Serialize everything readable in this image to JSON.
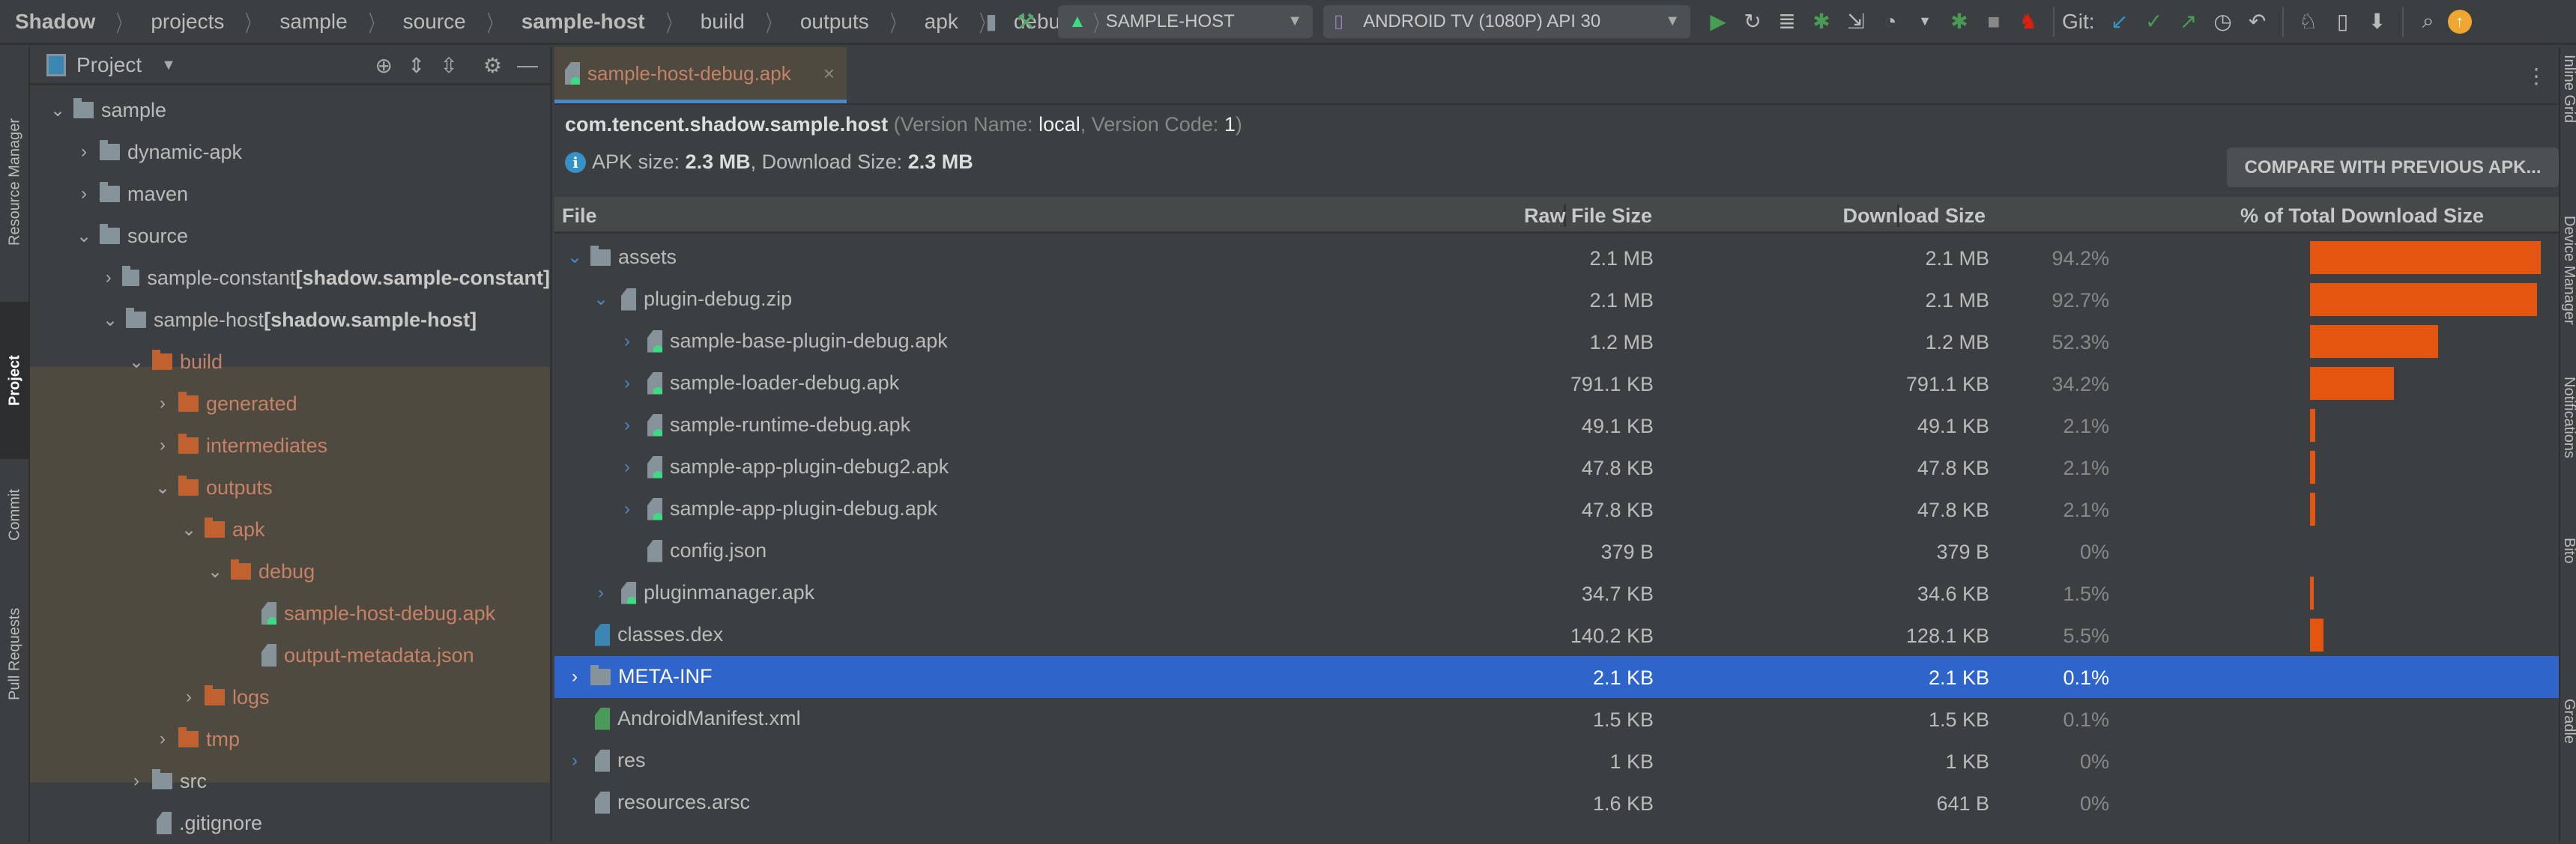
{
  "breadcrumbs": [
    {
      "label": "Shadow",
      "bold": true
    },
    {
      "label": "projects"
    },
    {
      "label": "sample"
    },
    {
      "label": "source"
    },
    {
      "label": "sample-host",
      "bold": true
    },
    {
      "label": "build"
    },
    {
      "label": "outputs"
    },
    {
      "label": "apk"
    },
    {
      "label": "debug"
    }
  ],
  "toolbar": {
    "run_config": "SAMPLE-HOST",
    "device": "ANDROID TV (1080P) API 30",
    "git_label": "Git:"
  },
  "left_strip": {
    "resource_manager": "Resource Manager",
    "project": "Project",
    "commit": "Commit",
    "pull_requests": "Pull Requests"
  },
  "right_strip": {
    "items": [
      "Inline Grid",
      "Device Manager",
      "Notifications",
      "Bito",
      "Gradle"
    ]
  },
  "project_panel": {
    "title": "Project",
    "tree": [
      {
        "label": "sample",
        "depth": 0,
        "chev": "down",
        "icon": "folder"
      },
      {
        "label": "dynamic-apk",
        "depth": 1,
        "chev": "right",
        "icon": "folder"
      },
      {
        "label": "maven",
        "depth": 1,
        "chev": "right",
        "icon": "folder"
      },
      {
        "label": "source",
        "depth": 1,
        "chev": "down",
        "icon": "folder"
      },
      {
        "label": "sample-constant ",
        "suffix": "[shadow.sample-constant]",
        "depth": 2,
        "chev": "right",
        "icon": "module"
      },
      {
        "label": "sample-host ",
        "suffix": "[shadow.sample-host]",
        "depth": 2,
        "chev": "down",
        "icon": "module"
      },
      {
        "label": "build",
        "depth": 3,
        "chev": "down",
        "icon": "folder",
        "excluded": true
      },
      {
        "label": "generated",
        "depth": 4,
        "chev": "right",
        "icon": "folder",
        "excluded": true
      },
      {
        "label": "intermediates",
        "depth": 4,
        "chev": "right",
        "icon": "folder",
        "excluded": true
      },
      {
        "label": "outputs",
        "depth": 4,
        "chev": "down",
        "icon": "folder",
        "excluded": true
      },
      {
        "label": "apk",
        "depth": 5,
        "chev": "down",
        "icon": "folder",
        "excluded": true
      },
      {
        "label": "debug",
        "depth": 6,
        "chev": "down",
        "icon": "folder",
        "excluded": true
      },
      {
        "label": "sample-host-debug.apk",
        "depth": 7,
        "chev": "none",
        "icon": "apk",
        "excluded": true
      },
      {
        "label": "output-metadata.json",
        "depth": 7,
        "chev": "none",
        "icon": "json",
        "excluded": true
      },
      {
        "label": "logs",
        "depth": 5,
        "chev": "right",
        "icon": "folder",
        "excluded": true
      },
      {
        "label": "tmp",
        "depth": 4,
        "chev": "right",
        "icon": "folder",
        "excluded": true
      },
      {
        "label": "src",
        "depth": 3,
        "chev": "right",
        "icon": "folder"
      },
      {
        "label": ".gitignore",
        "depth": 3,
        "chev": "none",
        "icon": "gitignore"
      }
    ]
  },
  "editor": {
    "tab_label": "sample-host-debug.apk",
    "package": "com.tencent.shadow.sample.host",
    "version_name_label": " (Version Name: ",
    "version_name": "local",
    "version_code_label": ", Version Code: ",
    "version_code": "1",
    "close_paren": ")",
    "apk_size_label": "APK size: ",
    "apk_size": "2.3 MB",
    "download_size_label": ", Download Size: ",
    "download_size": "2.3 MB",
    "compare_button": "COMPARE WITH PREVIOUS APK...",
    "columns": {
      "file": "File",
      "raw": "Raw File Size",
      "download": "Download Size",
      "percent": "% of Total Download Size"
    },
    "colors": {
      "bar": "#e4560f",
      "selected": "#2f65ca"
    },
    "rows": [
      {
        "name": "assets",
        "depth": 0,
        "chev": "down",
        "icon": "folder",
        "raw": "2.1 MB",
        "dl": "2.1 MB",
        "pct": "94.2%",
        "pct_value": 94.2
      },
      {
        "name": "plugin-debug.zip",
        "depth": 1,
        "chev": "down",
        "icon": "zip",
        "raw": "2.1 MB",
        "dl": "2.1 MB",
        "pct": "92.7%",
        "pct_value": 92.7
      },
      {
        "name": "sample-base-plugin-debug.apk",
        "depth": 2,
        "chev": "right",
        "icon": "apk",
        "raw": "1.2 MB",
        "dl": "1.2 MB",
        "pct": "52.3%",
        "pct_value": 52.3
      },
      {
        "name": "sample-loader-debug.apk",
        "depth": 2,
        "chev": "right",
        "icon": "apk",
        "raw": "791.1 KB",
        "dl": "791.1 KB",
        "pct": "34.2%",
        "pct_value": 34.2
      },
      {
        "name": "sample-runtime-debug.apk",
        "depth": 2,
        "chev": "right",
        "icon": "apk",
        "raw": "49.1 KB",
        "dl": "49.1 KB",
        "pct": "2.1%",
        "pct_value": 2.1
      },
      {
        "name": "sample-app-plugin-debug2.apk",
        "depth": 2,
        "chev": "right",
        "icon": "apk",
        "raw": "47.8 KB",
        "dl": "47.8 KB",
        "pct": "2.1%",
        "pct_value": 2.1
      },
      {
        "name": "sample-app-plugin-debug.apk",
        "depth": 2,
        "chev": "right",
        "icon": "apk",
        "raw": "47.8 KB",
        "dl": "47.8 KB",
        "pct": "2.1%",
        "pct_value": 2.1
      },
      {
        "name": "config.json",
        "depth": 2,
        "chev": "none",
        "icon": "json",
        "raw": "379 B",
        "dl": "379 B",
        "pct": "0%",
        "pct_value": 0
      },
      {
        "name": "pluginmanager.apk",
        "depth": 1,
        "chev": "right",
        "icon": "apk",
        "raw": "34.7 KB",
        "dl": "34.6 KB",
        "pct": "1.5%",
        "pct_value": 1.5
      },
      {
        "name": "classes.dex",
        "depth": 0,
        "chev": "none",
        "icon": "dex",
        "raw": "140.2 KB",
        "dl": "128.1 KB",
        "pct": "5.5%",
        "pct_value": 5.5
      },
      {
        "name": "META-INF",
        "depth": 0,
        "chev": "right",
        "icon": "folder",
        "raw": "2.1 KB",
        "dl": "2.1 KB",
        "pct": "0.1%",
        "pct_value": 0.1,
        "selected": true
      },
      {
        "name": "AndroidManifest.xml",
        "depth": 0,
        "chev": "none",
        "icon": "manifest",
        "raw": "1.5 KB",
        "dl": "1.5 KB",
        "pct": "0.1%",
        "pct_value": 0.1
      },
      {
        "name": "res",
        "depth": 0,
        "chev": "right",
        "icon": "res",
        "raw": "1 KB",
        "dl": "1 KB",
        "pct": "0%",
        "pct_value": 0
      },
      {
        "name": "resources.arsc",
        "depth": 0,
        "chev": "none",
        "icon": "arsc",
        "raw": "1.6 KB",
        "dl": "641 B",
        "pct": "0%",
        "pct_value": 0
      }
    ]
  }
}
